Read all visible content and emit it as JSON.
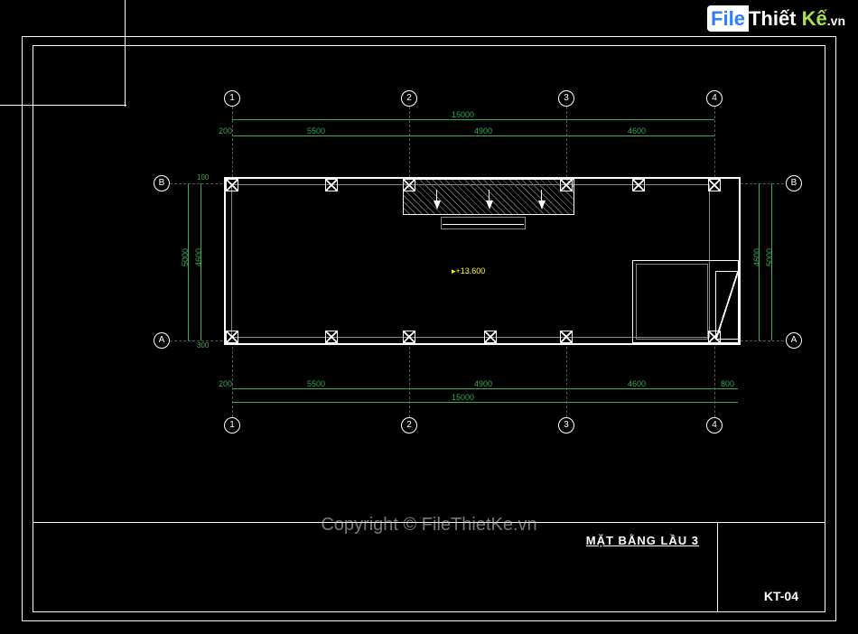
{
  "watermark": {
    "file": "File",
    "thiet": "Thiết",
    "ke": "Kế",
    "vn": ".vn",
    "copyright": "Copyright © FileThietKe.vn"
  },
  "title_block": {
    "drawing_title": "MẶT BẰNG LẦU 3",
    "sheet_no": "KT-04"
  },
  "grid": {
    "cols": [
      "1",
      "2",
      "3",
      "4"
    ],
    "rows": [
      "A",
      "B"
    ]
  },
  "dimensions": {
    "overall_width": "15000",
    "col_1_2": "5500",
    "col_2_3": "4900",
    "col_3_4": "4600",
    "right_ext": "800",
    "overall_height": "5000",
    "row_inner": "4600",
    "row_edge_top": "100",
    "row_edge_bot": "300",
    "left_edge": "200"
  },
  "elevation": "+13.600"
}
